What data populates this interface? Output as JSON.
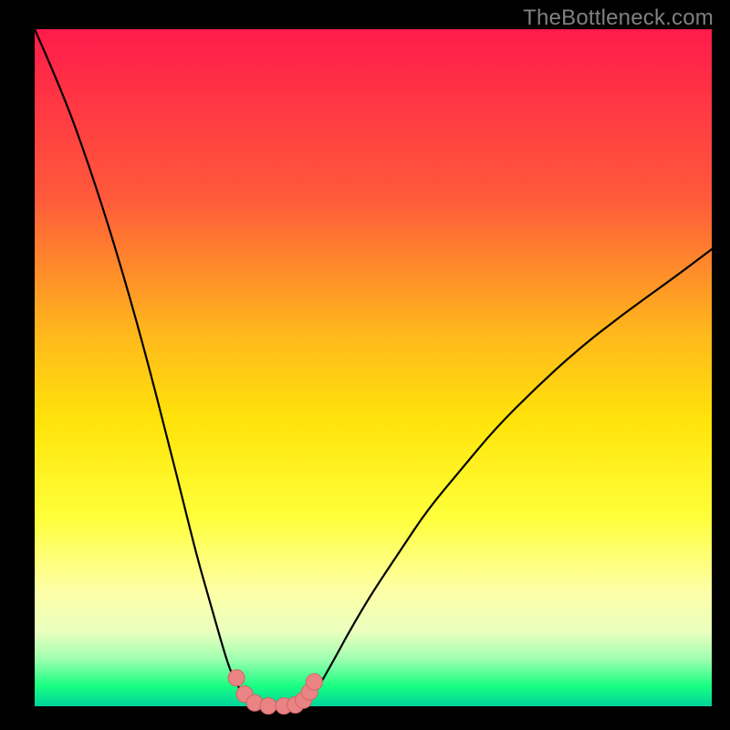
{
  "watermark": "TheBottleneck.com",
  "colors": {
    "background": "#000000",
    "curve_stroke": "#000000",
    "marker_fill": "#ea8484",
    "marker_stroke": "#d06464"
  },
  "chart_data": {
    "type": "line",
    "title": "",
    "xlabel": "",
    "ylabel": "",
    "xlim": [
      0,
      100
    ],
    "ylim": [
      0,
      100
    ],
    "grid": false,
    "legend": false,
    "series": [
      {
        "name": "left-branch",
        "x": [
          0,
          4,
          8,
          12,
          16,
          20,
          22,
          24,
          26,
          28,
          29,
          30,
          31,
          32,
          33,
          34
        ],
        "values": [
          100,
          91,
          80,
          67.5,
          53.5,
          38,
          30,
          22,
          15,
          8,
          5,
          3,
          1.5,
          0.6,
          0.2,
          0.05
        ]
      },
      {
        "name": "floor",
        "x": [
          34,
          35,
          36,
          37,
          38
        ],
        "values": [
          0.05,
          0.03,
          0.03,
          0.03,
          0.05
        ]
      },
      {
        "name": "right-branch",
        "x": [
          38,
          39,
          40,
          41,
          42,
          44,
          47,
          50,
          54,
          58,
          63,
          68,
          74,
          80,
          87,
          94,
          100
        ],
        "values": [
          0.05,
          0.2,
          0.7,
          1.6,
          3,
          6.5,
          12,
          17,
          23,
          29,
          35,
          41,
          47,
          52.5,
          58,
          63,
          67.5
        ]
      }
    ],
    "markers": {
      "name": "highlighted-points",
      "x": [
        29.8,
        31.0,
        32.5,
        34.5,
        36.8,
        38.5,
        39.7,
        40.6,
        41.3
      ],
      "values": [
        4.2,
        1.8,
        0.5,
        0.05,
        0.05,
        0.2,
        0.9,
        2.1,
        3.6
      ]
    }
  }
}
